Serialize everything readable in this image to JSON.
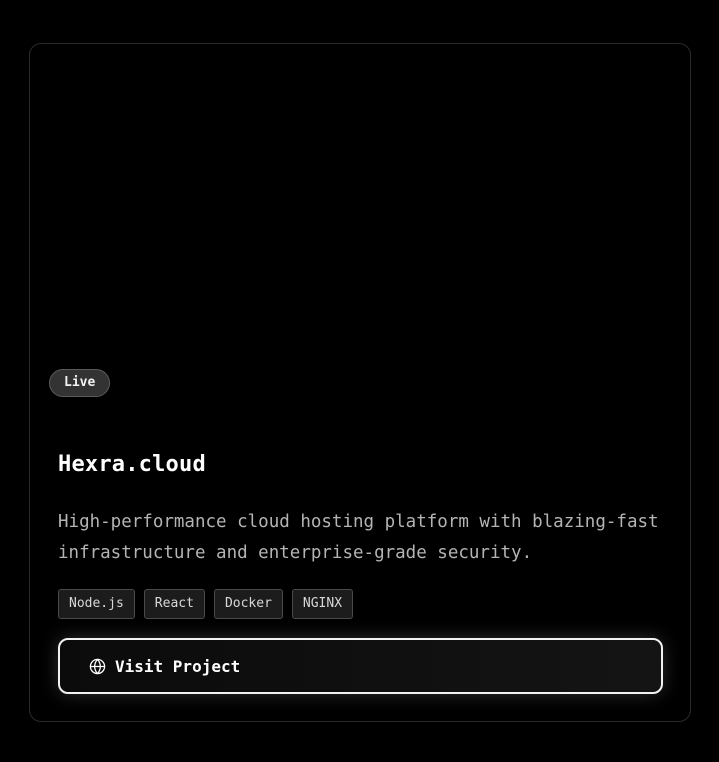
{
  "card": {
    "status": "Live",
    "title": "Hexra.cloud",
    "description": "High-performance cloud hosting platform with blazing-fast infrastructure and enterprise-grade security.",
    "tags": [
      "Node.js",
      "React",
      "Docker",
      "NGINX"
    ],
    "visit_button": {
      "icon": "globe-icon",
      "label": "Visit Project"
    }
  },
  "colors": {
    "background": "#000000",
    "card_border": "#2a2a2a",
    "badge_background": "#333333",
    "description_text": "#b4b4b4",
    "button_border": "#f2f2f2"
  }
}
